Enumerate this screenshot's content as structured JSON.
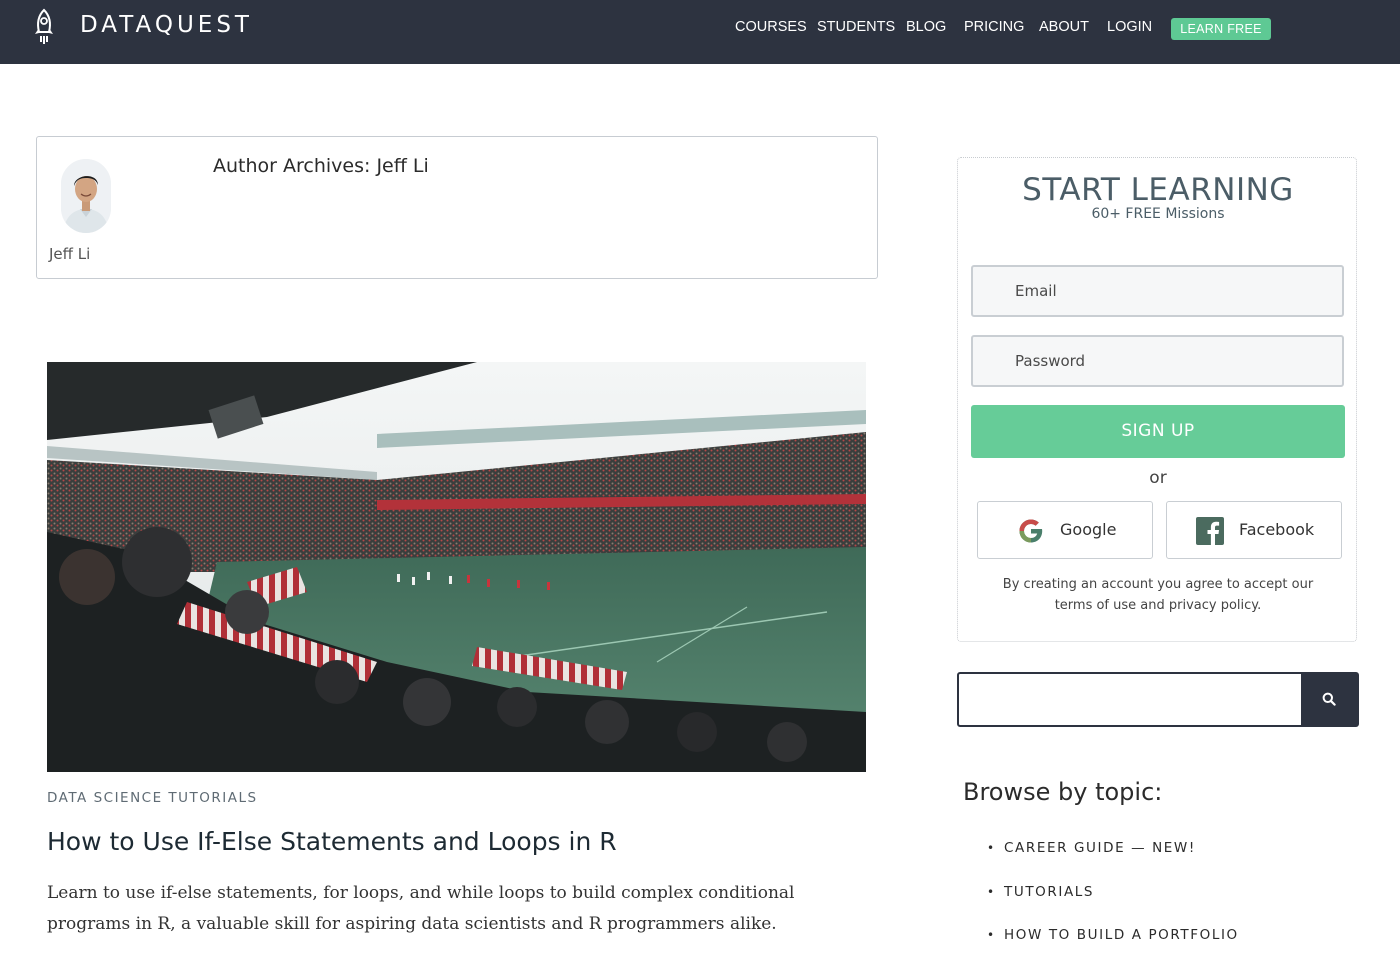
{
  "brand": {
    "name": "DATAQUEST",
    "logo_icon": "rocket-icon"
  },
  "nav": {
    "links": [
      "COURSES",
      "STUDENTS",
      "BLOG",
      "PRICING",
      "ABOUT",
      "LOGIN"
    ],
    "cta": "LEARN FREE"
  },
  "author": {
    "name": "Jeff Li",
    "archive_title": "Author Archives: Jeff Li"
  },
  "post": {
    "category": "DATA SCIENCE TUTORIALS",
    "title": "How to Use If-Else Statements and Loops in R",
    "excerpt": "Learn to use if-else statements, for loops, and while loops to build complex conditional programs in R, a valuable skill for aspiring data scientists and R programmers alike."
  },
  "signup": {
    "title": "START LEARNING",
    "subtitle": "60+ FREE Missions",
    "email_placeholder": "Email",
    "password_placeholder": "Password",
    "button": "SIGN UP",
    "or": "or",
    "google": "Google",
    "facebook": "Facebook",
    "terms_line1": "By creating an account you agree to accept our",
    "terms_line2": "terms of use and privacy policy."
  },
  "search": {
    "value": "",
    "icon": "search-icon"
  },
  "browse": {
    "title": "Browse by topic:",
    "topics": [
      "CAREER GUIDE — NEW!",
      "TUTORIALS",
      "HOW TO BUILD A PORTFOLIO"
    ]
  },
  "colors": {
    "navbar": "#2d3340",
    "accent_green": "#5ec994",
    "heading_slate": "#4b5d67"
  }
}
